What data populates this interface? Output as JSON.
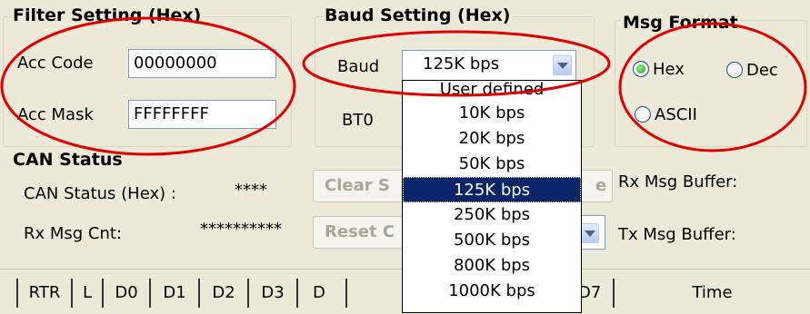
{
  "filter": {
    "title": "Filter Setting (Hex)",
    "acc_code_label": "Acc Code",
    "acc_code_value": "00000000",
    "acc_mask_label": "Acc Mask",
    "acc_mask_value": "FFFFFFFF"
  },
  "baud": {
    "title": "Baud Setting (Hex)",
    "baud_label": "Baud",
    "selected": "125K bps",
    "bt0_label": "BT0",
    "options": [
      "User defined",
      "10K bps",
      "20K bps",
      "50K bps",
      "125K bps",
      "250K bps",
      "500K bps",
      "800K bps",
      "1000K bps"
    ],
    "highlighted_index": 4
  },
  "msg_format": {
    "title": "Msg Format",
    "options": [
      "Hex",
      "Dec",
      "ASCII"
    ],
    "selected": "Hex"
  },
  "can_status": {
    "title": "CAN Status",
    "status_label": "CAN Status (Hex) :",
    "status_value": "****",
    "rx_cnt_label": "Rx Msg Cnt:",
    "rx_cnt_value": "**********",
    "clear_button_label": "Clear S",
    "clear_button_tail": "e",
    "reset_button_label": "Reset C"
  },
  "buffers": {
    "rx_label": "Rx Msg Buffer:",
    "tx_label": "Tx Msg Buffer:"
  },
  "table": {
    "columns": [
      "RTR",
      "L",
      "D0",
      "D1",
      "D2",
      "D3",
      "D",
      "D7",
      "Time"
    ]
  },
  "colors": {
    "annotation": "#e00000",
    "selection": "#0a246a",
    "window_bg": "#ece9d8"
  }
}
